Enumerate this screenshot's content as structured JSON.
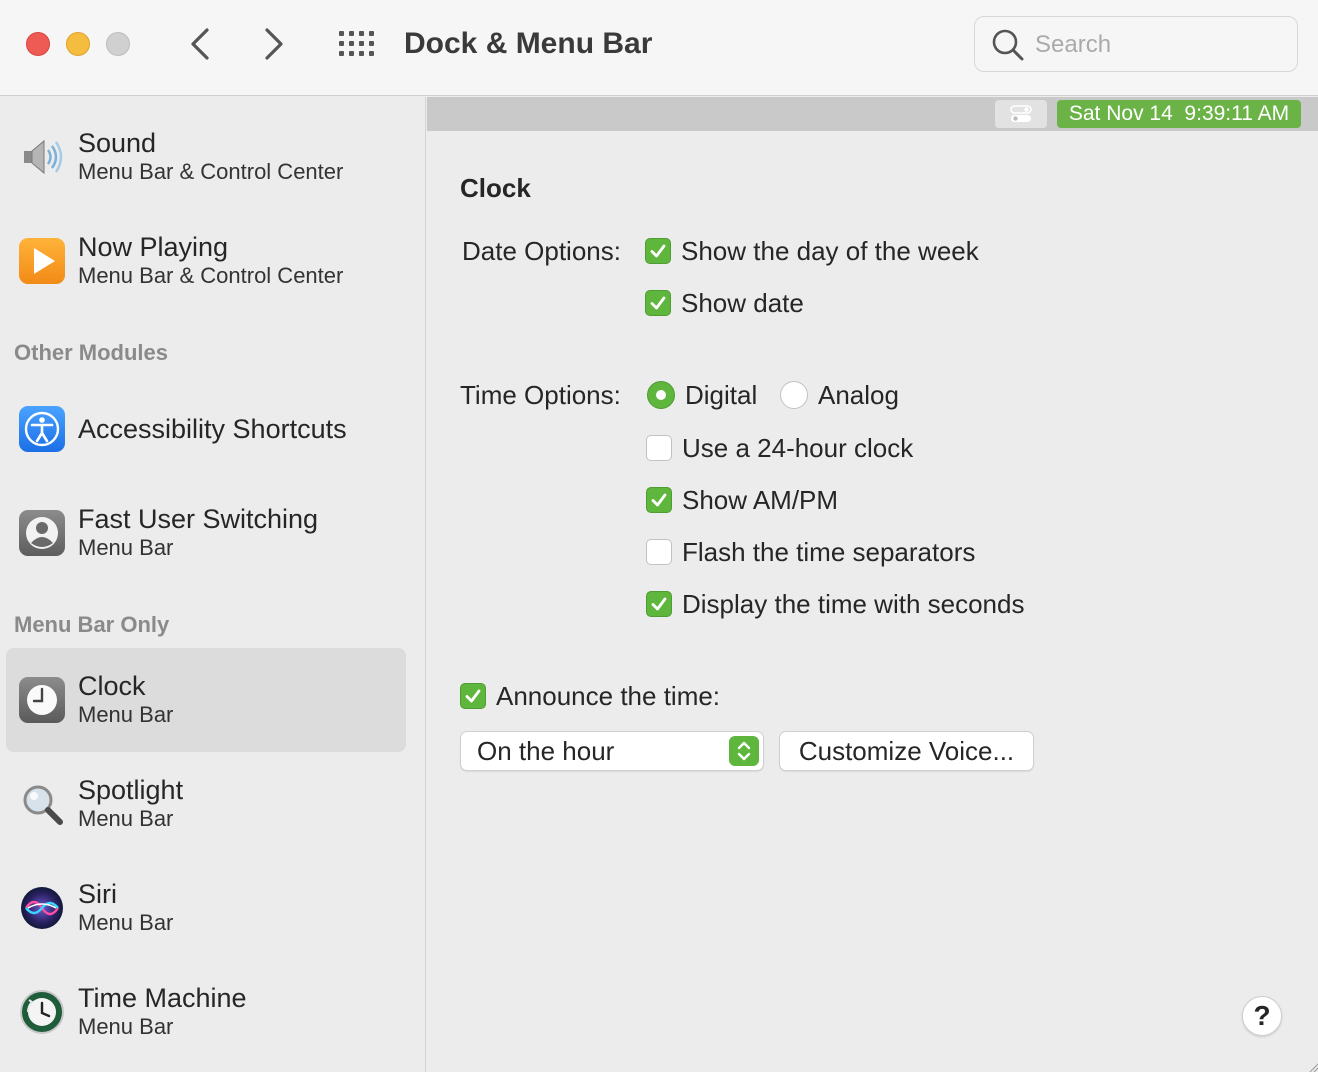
{
  "window": {
    "title": "Dock & Menu Bar",
    "search_placeholder": "Search"
  },
  "sidebar": {
    "items_top": [
      {
        "title": "Sound",
        "subtitle": "Menu Bar & Control Center",
        "icon": "speaker-icon"
      },
      {
        "title": "Now Playing",
        "subtitle": "Menu Bar & Control Center",
        "icon": "play-icon"
      }
    ],
    "section_other": "Other Modules",
    "items_other": [
      {
        "title": "Accessibility Shortcuts",
        "icon": "accessibility-icon"
      },
      {
        "title": "Fast User Switching",
        "subtitle": "Menu Bar",
        "icon": "user-icon"
      }
    ],
    "section_menubar": "Menu Bar Only",
    "items_menubar": [
      {
        "title": "Clock",
        "subtitle": "Menu Bar",
        "icon": "clock-icon",
        "selected": true
      },
      {
        "title": "Spotlight",
        "subtitle": "Menu Bar",
        "icon": "magnifier-icon"
      },
      {
        "title": "Siri",
        "subtitle": "Menu Bar",
        "icon": "siri-icon"
      },
      {
        "title": "Time Machine",
        "subtitle": "Menu Bar",
        "icon": "time-machine-icon"
      }
    ]
  },
  "menubar_preview": {
    "clock_text": "Sat Nov 14  9:39:11 AM",
    "accent_color": "#6cb347"
  },
  "clock": {
    "section_title": "Clock",
    "date_options_label": "Date Options:",
    "date_options": [
      {
        "label": "Show the day of the week",
        "checked": true
      },
      {
        "label": "Show date",
        "checked": true
      }
    ],
    "time_options_label": "Time Options:",
    "time_style": {
      "digital_label": "Digital",
      "analog_label": "Analog",
      "selected": "Digital"
    },
    "time_options": [
      {
        "label": "Use a 24-hour clock",
        "checked": false
      },
      {
        "label": "Show AM/PM",
        "checked": true
      },
      {
        "label": "Flash the time separators",
        "checked": false
      },
      {
        "label": "Display the time with seconds",
        "checked": true
      }
    ],
    "announce": {
      "label": "Announce the time:",
      "checked": true
    },
    "announce_interval": "On the hour",
    "customize_voice_label": "Customize Voice...",
    "help_label": "?"
  },
  "colors": {
    "accent_green": "#5fb63d",
    "close": "#ee5b55",
    "minimize": "#f4bd3f",
    "zoom_disabled": "#d0d0d0"
  }
}
